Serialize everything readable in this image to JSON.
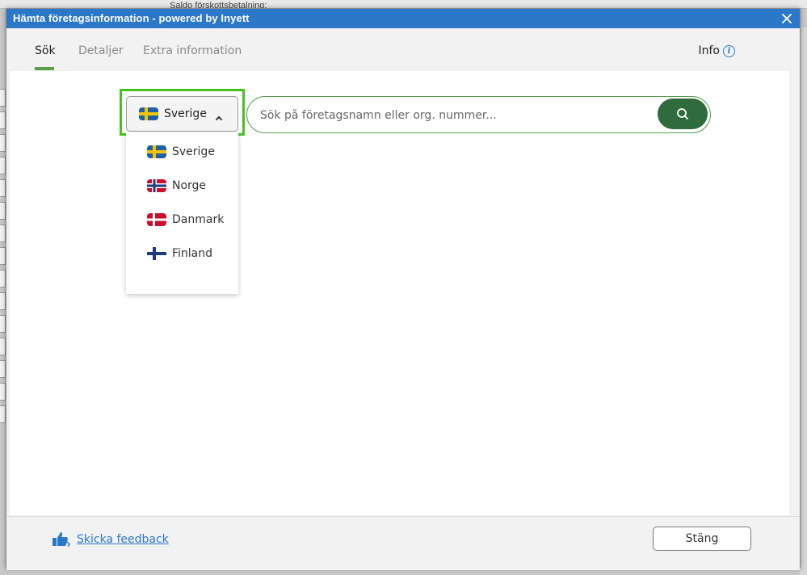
{
  "background": {
    "partial_text": "Saldo förskottsbetalning:"
  },
  "dialog": {
    "title": "Hämta företagsinformation - powered by Inyett",
    "close_icon": "close-icon"
  },
  "tabs": [
    {
      "label": "Sök",
      "active": true
    },
    {
      "label": "Detaljer",
      "active": false
    },
    {
      "label": "Extra information",
      "active": false
    }
  ],
  "info": {
    "label": "Info",
    "icon": "info-icon"
  },
  "country_select": {
    "selected": "Sverige",
    "selected_flag": "sweden-flag-icon",
    "chevron": "chevron-up-icon"
  },
  "country_options": [
    {
      "label": "Sverige",
      "flag": "sweden-flag-icon"
    },
    {
      "label": "Norge",
      "flag": "norway-flag-icon"
    },
    {
      "label": "Danmark",
      "flag": "denmark-flag-icon"
    },
    {
      "label": "Finland",
      "flag": "finland-flag-icon"
    }
  ],
  "search": {
    "placeholder": "Sök på företagsnamn eller org. nummer...",
    "value": "",
    "button_icon": "search-icon"
  },
  "footer": {
    "feedback_label": "Skicka feedback",
    "feedback_icon": "thumbs-feedback-icon",
    "close_label": "Stäng"
  },
  "colors": {
    "titlebar": "#2b78c9",
    "accent_green": "#5aa046",
    "search_button": "#2f6b3c",
    "highlight": "#46c21c",
    "link": "#2b78c9"
  }
}
